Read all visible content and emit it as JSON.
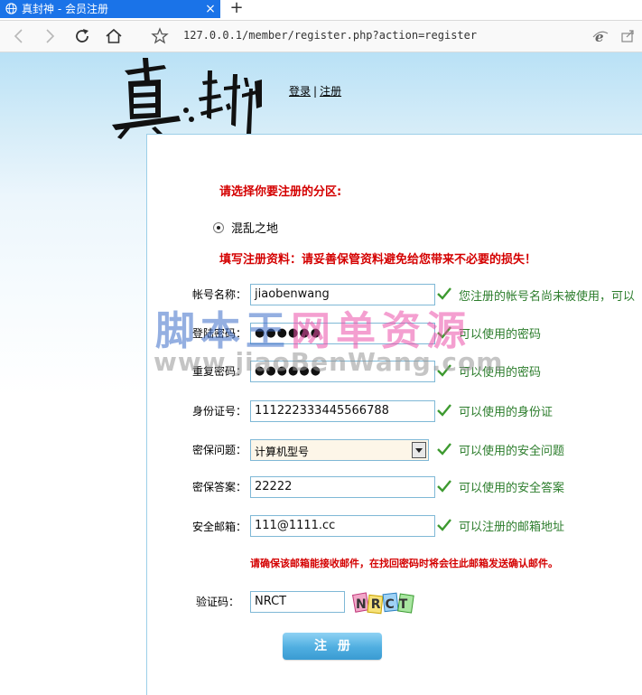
{
  "browser": {
    "tab_title": "真封神 - 会员注册",
    "tab_close": "×",
    "new_tab": "+",
    "url": "127.0.0.1/member/register.php?action=register"
  },
  "header": {
    "login_link": "登录",
    "separator": "|",
    "register_link": "注册"
  },
  "form": {
    "zone_title": "请选择你要注册的分区:",
    "zone_option": "混乱之地",
    "zone_selected": true,
    "info_title": "填写注册资料：请妥善保管资料避免给您带来不必要的损失！",
    "fields": [
      {
        "label": "帐号名称：",
        "value": "jiaobenwang",
        "hint": "您注册的帐号名尚未被使用，可以"
      },
      {
        "label": "登陆密码：",
        "value": "●●●●●●",
        "hint": "可以使用的密码"
      },
      {
        "label": "重复密码：",
        "value": "●●●●●●",
        "hint": "可以使用的密码"
      },
      {
        "label": "身份证号：",
        "value": "111222333445566788",
        "hint": "可以使用的身份证"
      },
      {
        "label": "密保问题：",
        "value": "计算机型号",
        "hint": "可以使用的安全问题"
      },
      {
        "label": "密保答案：",
        "value": "22222",
        "hint": "可以使用的安全答案"
      },
      {
        "label": "安全邮箱：",
        "value": "111@1111.cc",
        "hint": "可以注册的邮箱地址"
      }
    ],
    "email_notice": "请确保该邮箱能接收邮件，在找回密码时将会往此邮箱发送确认邮件。",
    "captcha_label": "验证码：",
    "captcha_value": "NRCT",
    "captcha_image_text": "NRCT",
    "submit_label": "注册"
  },
  "watermark": {
    "line1_a": "脚本王",
    "line1_b": "网单资源",
    "line2": "www.jiaoBenWang.com"
  },
  "colors": {
    "tab_active": "#1a73e8",
    "red_title": "#d40000",
    "hint_green": "#2c7d2c",
    "check_green": "#3d9a30",
    "field_border": "#7fb8d6",
    "button_blue": "#4faee0"
  }
}
